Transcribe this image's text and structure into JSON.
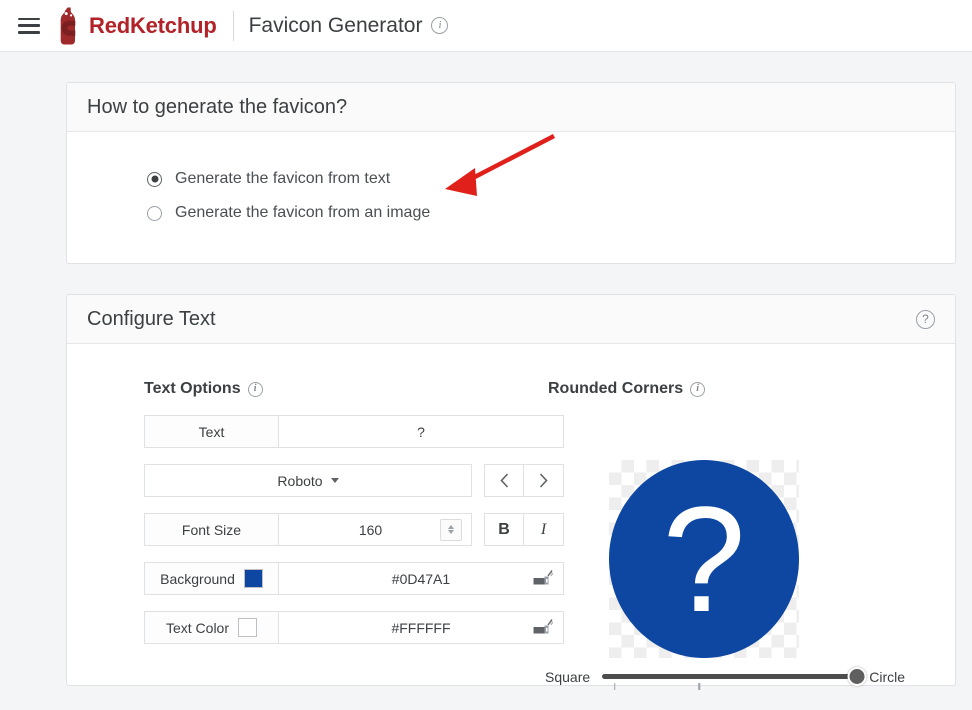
{
  "appbar": {
    "menu_icon": "hamburger-menu-icon",
    "brand": "RedKetchup",
    "logo_icon": "ketchup-bottle-logo",
    "title": "Favicon Generator",
    "info_icon": "info-icon",
    "brand_color": "#b12328"
  },
  "method_card": {
    "heading": "How to generate the favicon?",
    "options": [
      {
        "label": "Generate the favicon from text",
        "selected": true
      },
      {
        "label": "Generate the favicon from an image",
        "selected": false
      }
    ]
  },
  "annotation": {
    "type": "arrow",
    "color": "#e0201b",
    "from": [
      553,
      136
    ],
    "to": [
      447,
      189
    ]
  },
  "config_card": {
    "heading": "Configure Text",
    "help_icon": "help-circle-icon",
    "text_options": {
      "title": "Text Options",
      "info_icon": "info-icon",
      "fields": {
        "text": {
          "label": "Text",
          "value": "?"
        },
        "font": {
          "label": "Roboto",
          "prev_icon": "chevron-left-icon",
          "next_icon": "chevron-right-icon"
        },
        "font_size": {
          "label": "Font Size",
          "value": "160",
          "stepper_icon": "spinner-updown-icon",
          "bold_label": "B",
          "italic_label": "I"
        },
        "background": {
          "label": "Background",
          "value": "#0D47A1",
          "swatch": "#0D47A1",
          "picker_icon": "color-picker-icon"
        },
        "text_color": {
          "label": "Text Color",
          "value": "#FFFFFF",
          "swatch": "#FFFFFF",
          "picker_icon": "color-picker-icon"
        }
      }
    },
    "rounded_corners": {
      "title": "Rounded Corners",
      "info_icon": "info-icon",
      "slider": {
        "min_label": "Square",
        "max_label": "Circle",
        "value": 100,
        "ticks": [
          5,
          38
        ]
      },
      "preview": {
        "glyph": "?",
        "background": "#0D47A1",
        "foreground": "#FFFFFF",
        "shape": "circle",
        "checker_light": "#ffffff",
        "checker_dark": "#eeeeee"
      }
    }
  }
}
